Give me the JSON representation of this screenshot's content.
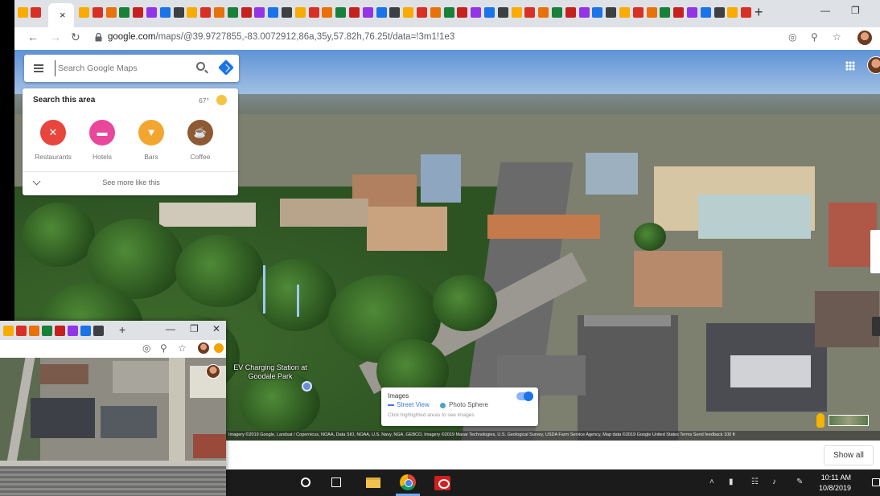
{
  "browser": {
    "url_host": "google.com",
    "url_path": "/maps/@39.9727855,-83.0072912,86a,35y,57.82h,76.25t/data=!3m1!1e3",
    "new_tab_label": "+",
    "tab_close_label": "×"
  },
  "maps": {
    "search": {
      "placeholder": "Search Google Maps"
    },
    "explore": {
      "title": "Search this area",
      "temperature": "67°",
      "categories": [
        {
          "label": "Restaurants",
          "icon": "restaurant-icon",
          "color": "#e8453c"
        },
        {
          "label": "Hotels",
          "icon": "hotel-icon",
          "color": "#e8479c"
        },
        {
          "label": "Bars",
          "icon": "bar-icon",
          "color": "#f2a630"
        },
        {
          "label": "Coffee",
          "icon": "coffee-icon",
          "color": "#8d5a34"
        }
      ],
      "see_more": "See more like this"
    },
    "place_label": "EV Charging Station at Goodale Park",
    "images_layer": {
      "title": "Images",
      "street_view": "Street View",
      "photo_sphere": "Photo Sphere",
      "hint": "Click highlighted areas to see images"
    },
    "attribution": "Imagery ©2019 Google, Landsat / Copernicus, NOAA, Data SIO, NOAA, U.S. Navy, NGA, GEBCO, Imagery ©2019 Maxar Technologies, U.S. Geological Survey, USDA Farm Service Agency, Map data ©2019 Google   United States   Terms   Send feedback   100 ft",
    "show_all_label": "Show all"
  },
  "taskbar": {
    "time": "10:11 AM",
    "date": "10/8/2019"
  },
  "colors": {
    "accent": "#1a73e8",
    "taskbar": "#1b1b1b",
    "tabstrip": "#dee1e6"
  }
}
